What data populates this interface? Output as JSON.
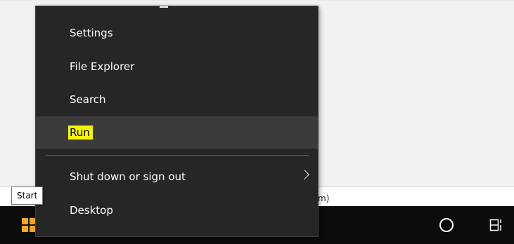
{
  "menu": {
    "items": [
      {
        "label": "Settings"
      },
      {
        "label": "File Explorer"
      },
      {
        "label": "Search"
      },
      {
        "label": "Run"
      },
      {
        "label": "Shut down or sign out"
      },
      {
        "label": "Desktop"
      }
    ]
  },
  "tooltip": {
    "text": "Start"
  },
  "background": {
    "fragment": "m)"
  },
  "taskbar": {
    "start_icon": "windows-logo-icon",
    "cortana_icon": "cortana-circle-icon",
    "taskview_icon": "task-view-icon"
  },
  "colors": {
    "menu_bg": "#262626",
    "menu_hover": "#3b3b3b",
    "highlight": "#f5f500",
    "taskbar": "#0c0c0c",
    "start_logo": "#f5a623"
  }
}
